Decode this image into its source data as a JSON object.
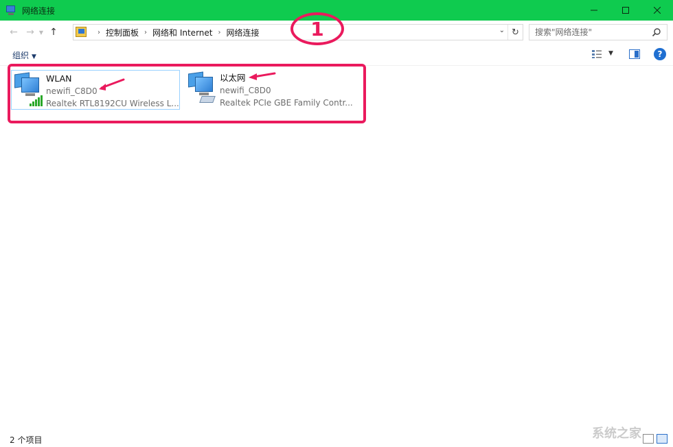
{
  "window": {
    "title": "网络连接",
    "minimize_icon": "minimize-icon",
    "maximize_icon": "maximize-icon",
    "close_icon": "close-icon"
  },
  "nav": {
    "back_icon": "back-arrow-icon",
    "forward_icon": "forward-arrow-icon",
    "recent_icon": "chevron-down-icon",
    "up_icon": "up-arrow-icon"
  },
  "address": {
    "crumbs": [
      "控制面板",
      "网络和 Internet",
      "网络连接"
    ]
  },
  "search": {
    "placeholder": "搜索\"网络连接\""
  },
  "command_bar": {
    "organize_label": "组织"
  },
  "items": [
    {
      "name": "WLAN",
      "network": "newifi_C8D0",
      "adapter": "Realtek RTL8192CU Wireless L...",
      "icon": "wireless-network-icon"
    },
    {
      "name": "以太网",
      "network": "newifi_C8D0",
      "adapter": "Realtek PCIe GBE Family Contr...",
      "icon": "ethernet-network-icon"
    }
  ],
  "annotation": {
    "badge_number": "1",
    "color": "#ea1a5d"
  },
  "status": {
    "count": "2 个项目"
  },
  "watermark": "系统之家",
  "colors": {
    "titlebar": "#0fcb4f",
    "accent": "#1f6fd1",
    "annotation": "#ea1a5d"
  }
}
